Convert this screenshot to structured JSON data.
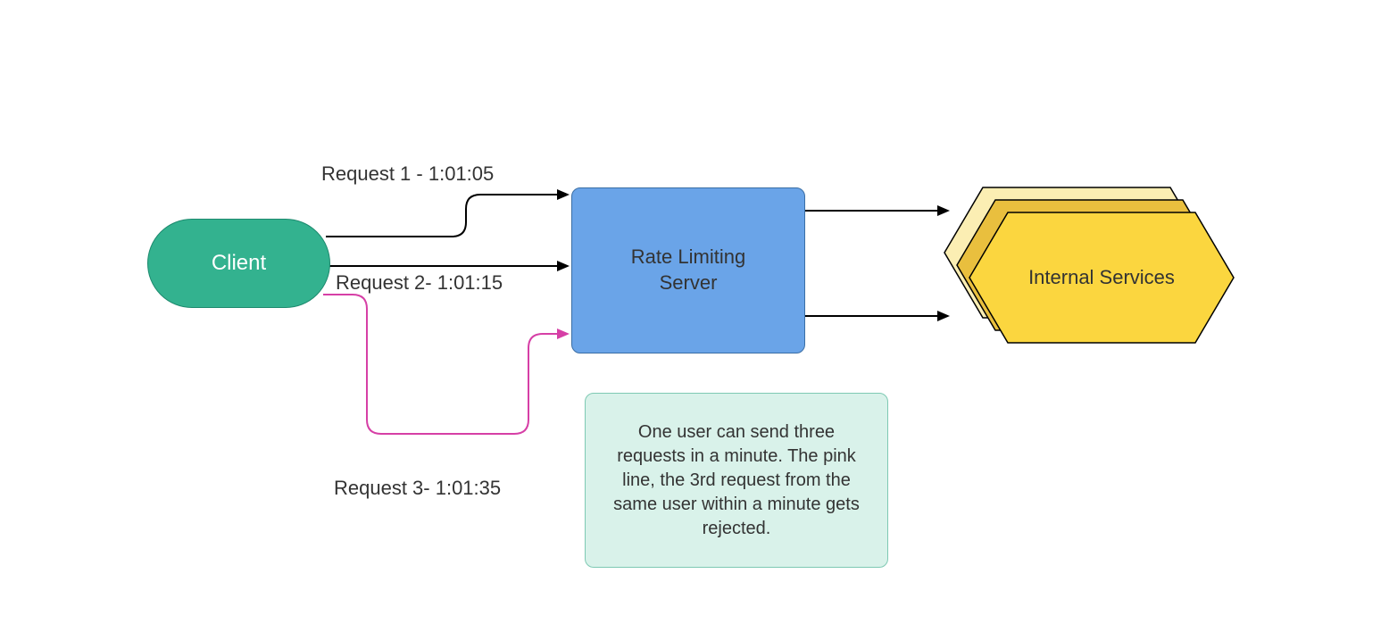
{
  "nodes": {
    "client": {
      "label": "Client"
    },
    "server": {
      "label_line1": "Rate Limiting",
      "label_line2": "Server"
    },
    "internal_services": {
      "label": "Internal Services"
    }
  },
  "edges": {
    "req1": {
      "label": "Request 1 - 1:01:05"
    },
    "req2": {
      "label": "Request 2- 1:01:15"
    },
    "req3": {
      "label": "Request 3- 1:01:35"
    }
  },
  "note": {
    "text": "One user can send three requests in a minute. The pink line, the 3rd request from the same user within a minute gets rejected."
  },
  "colors": {
    "client_fill": "#33b28f",
    "server_fill": "#6aa4e8",
    "note_fill": "#d9f2ea",
    "hex_fill_back": "#fbeeb3",
    "hex_fill_mid": "#e9bf3e",
    "hex_fill_front": "#fbd63f",
    "arrow_black": "#000000",
    "arrow_pink": "#d63fa6"
  }
}
